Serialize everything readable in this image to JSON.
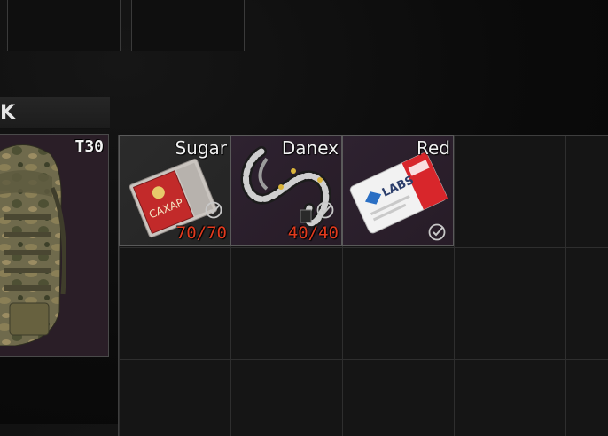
{
  "window": {
    "section_header": "K"
  },
  "backpack": {
    "tag": "T30",
    "icon": "backpack-icon"
  },
  "items": [
    {
      "name": "Sugar",
      "count": "70/70",
      "icon": "sugar-pack-icon",
      "checked": true
    },
    {
      "name": "Danex",
      "count": "40/40",
      "icon": "danex-cable-icon",
      "checked": true
    },
    {
      "name": "Red",
      "count": "",
      "icon": "labs-keycard-icon",
      "checked": true
    }
  ],
  "art_text": {
    "sugar_pack": "САХАР",
    "keycard_brand": "LABS"
  },
  "colors": {
    "count_text": "#e23a1e",
    "item_bg_purple": "#2a1e27",
    "grid_line": "#2e2e2e",
    "background": "#0b0b0b"
  }
}
